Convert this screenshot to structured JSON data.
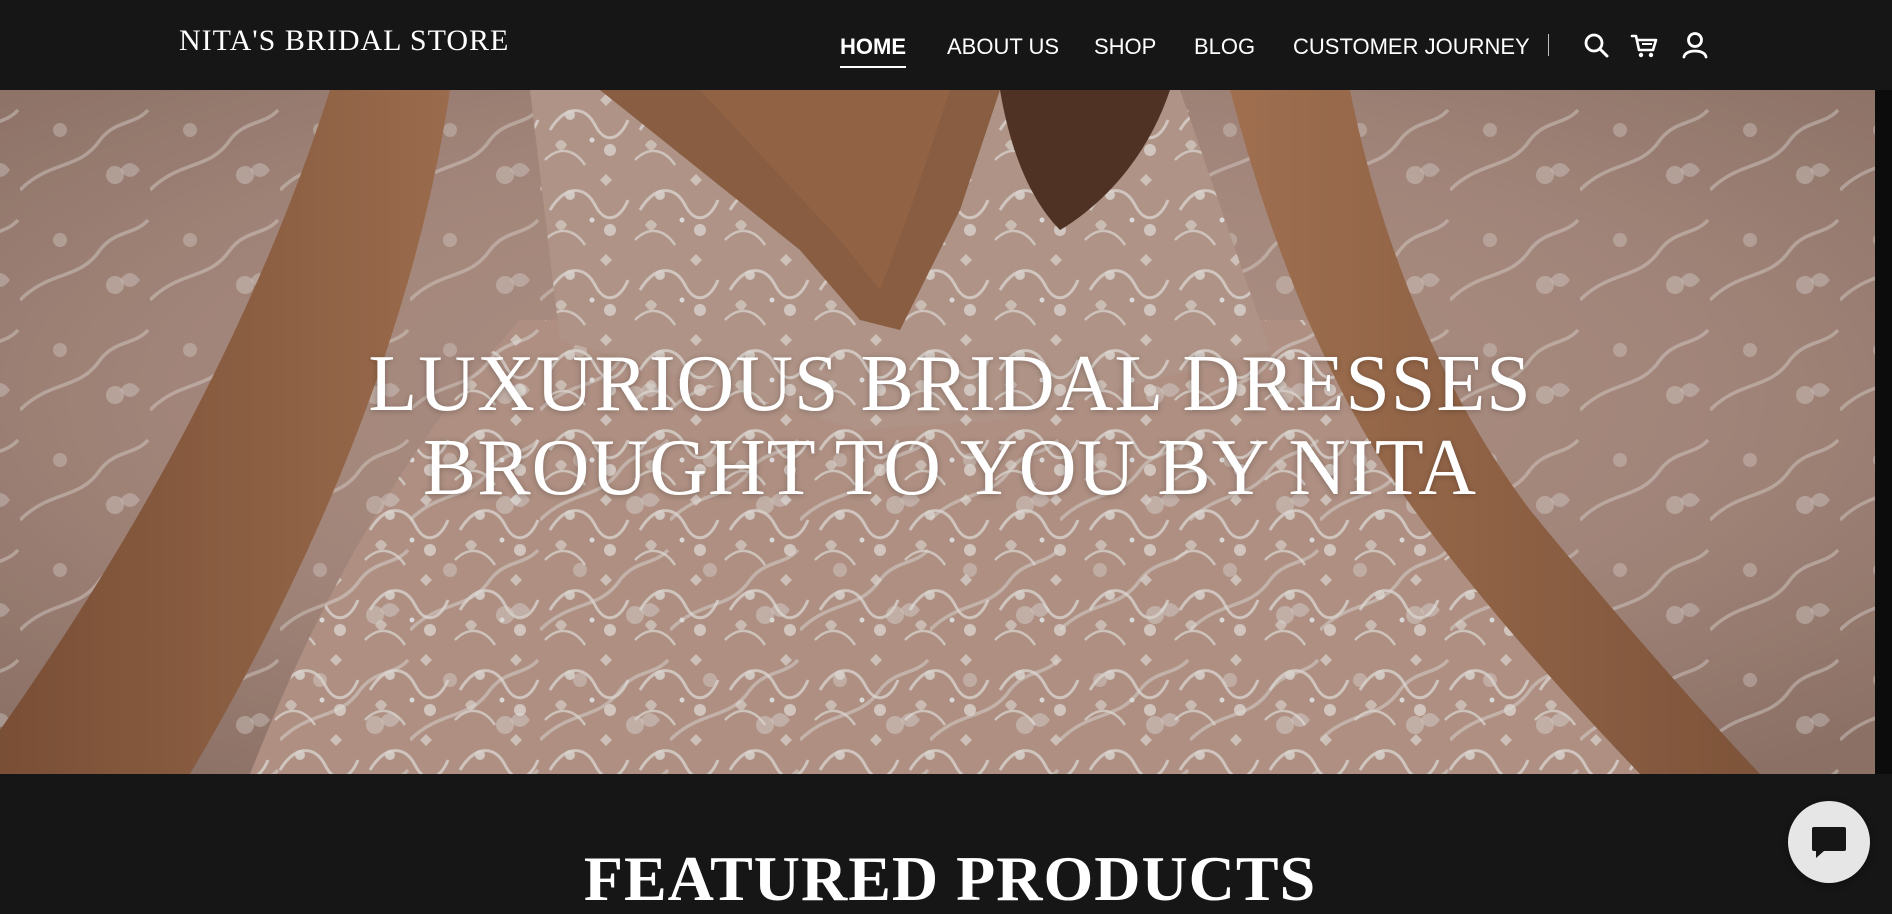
{
  "header": {
    "logo": "NITA'S BRIDAL STORE",
    "nav": [
      {
        "label": "HOME",
        "active": true
      },
      {
        "label": "ABOUT US",
        "active": false
      },
      {
        "label": "SHOP",
        "active": false
      },
      {
        "label": "BLOG",
        "active": false
      },
      {
        "label": "CUSTOMER JOURNEY",
        "active": false
      }
    ],
    "icons": [
      "search-icon",
      "cart-icon",
      "account-icon"
    ]
  },
  "hero": {
    "title_line1": "LUXURIOUS BRIDAL DRESSES",
    "title_line2": "BROUGHT TO YOU BY NITA",
    "image": "bridal-lace-gown-photo"
  },
  "featured": {
    "title": "FEATURED PRODUCTS"
  },
  "chat": {
    "icon": "chat-icon"
  },
  "colors": {
    "header_bg": "#161616",
    "text": "#ffffff",
    "hero_tone": "#b59888",
    "lace": "#f3ece6"
  }
}
